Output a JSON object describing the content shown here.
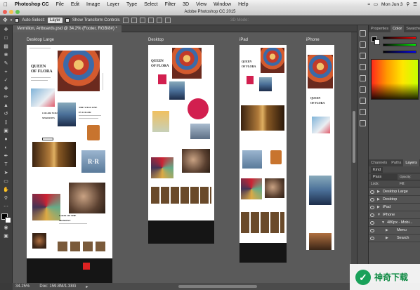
{
  "menubar": {
    "app": "Photoshop CC",
    "items": [
      "File",
      "Edit",
      "Image",
      "Layer",
      "Type",
      "Select",
      "Filter",
      "3D",
      "View",
      "Window",
      "Help"
    ],
    "clock": "Mon Jun 3"
  },
  "titlebar": {
    "title": "Adobe Photoshop CC 2015"
  },
  "options": {
    "auto_select": "Auto-Select:",
    "auto_select_target": "Layer",
    "transform": "Show Transform Controls",
    "mode": "3D Mode:"
  },
  "document": {
    "tab": "Vermilion, Artboards.psd @ 34.2% (Footer, RGB/8#) *"
  },
  "artboards": [
    "Desktop Large",
    "Desktop",
    "iPad",
    "iPhone"
  ],
  "status": {
    "zoom": "34.25%",
    "doc": "Doc: 159.8M/1.38G"
  },
  "panels": {
    "color_tabs": [
      "Properties",
      "Color",
      "Swatches"
    ],
    "layer_tabs": [
      "Channels",
      "Paths",
      "Layers"
    ],
    "kind": "Kind",
    "blend": "Pass Through",
    "opacity_label": "Opacity:",
    "opacity": "100%",
    "lock_label": "Lock:",
    "fill_label": "Fill:",
    "fill": "100%",
    "layers": [
      "Desktop Large",
      "Desktop",
      "iPad",
      "iPhone",
      "480px - Mobi...",
      "Menu",
      "Search"
    ]
  },
  "watermark": {
    "text": "神奇下载"
  },
  "colors": {
    "accent_red": "#d21f4f",
    "watermark_green": "#19a15a"
  }
}
